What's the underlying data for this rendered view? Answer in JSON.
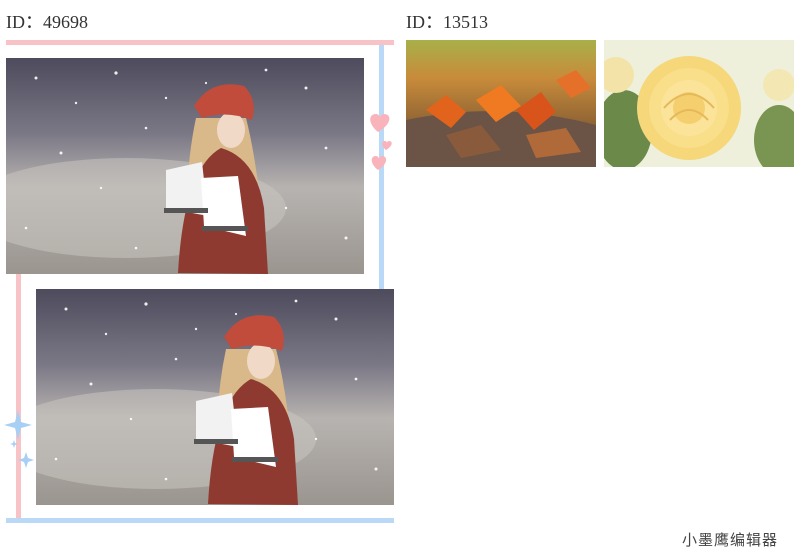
{
  "collage_left": {
    "id_label": "ID：49698"
  },
  "collage_right": {
    "id_label": "ID：13513"
  },
  "watermark": "小墨鹰编辑器",
  "colors": {
    "pink": "#f8c3c7",
    "blue": "#b9d9f7"
  }
}
